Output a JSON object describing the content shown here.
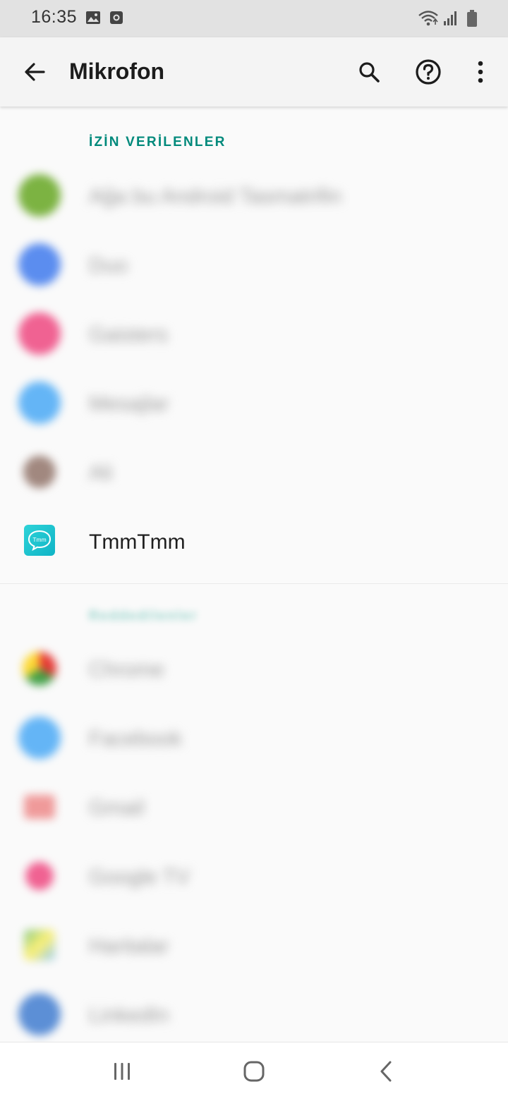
{
  "status_bar": {
    "time": "16:35",
    "left_icons": [
      "gallery-icon",
      "screen-record-icon"
    ],
    "right_icons": [
      "wifi-icon",
      "signal-icon",
      "battery-icon"
    ]
  },
  "app_bar": {
    "title": "Mikrofon",
    "actions": [
      "search-icon",
      "help-icon",
      "more-vert-icon"
    ]
  },
  "sections": {
    "allowed": {
      "header": "İZİN VERİLENLER",
      "items": [
        {
          "label": "Ağa bu Android Tasmatrifin",
          "icon_color": "#7cb342",
          "blurred": true
        },
        {
          "label": "Duo",
          "icon_color": "#5b8def",
          "blurred": true
        },
        {
          "label": "Gaisters",
          "icon_color": "#f06292",
          "blurred": true
        },
        {
          "label": "Mesajlar",
          "icon_color": "#64b5f6",
          "blurred": true
        },
        {
          "label": "Ali",
          "icon_color": "#a1887f",
          "blurred": true
        },
        {
          "label": "TmmTmm",
          "icon_color": "#1ec6d0",
          "blurred": false
        }
      ]
    },
    "denied": {
      "header": "Reddedilenler",
      "items": [
        {
          "label": "Chrome",
          "icon_color": "#e57373",
          "blurred": true
        },
        {
          "label": "Facebook",
          "icon_color": "#64b5f6",
          "blurred": true
        },
        {
          "label": "Gmail",
          "icon_color": "#ef9a9a",
          "blurred": true
        },
        {
          "label": "Google TV",
          "icon_color": "#f06292",
          "blurred": true
        },
        {
          "label": "Haritalar",
          "icon_color": "#81c784",
          "blurred": true
        },
        {
          "label": "LinkedIn",
          "icon_color": "#5c8fd6",
          "blurred": true
        }
      ]
    }
  },
  "tmm_icon_text": "Tmm",
  "nav_bar": {
    "buttons": [
      "recents-icon",
      "home-icon",
      "back-nav-icon"
    ]
  },
  "colors": {
    "accent": "#00897b",
    "status_bar": "#e2e2e2",
    "app_bar": "#f4f4f4",
    "background": "#fafafa"
  }
}
